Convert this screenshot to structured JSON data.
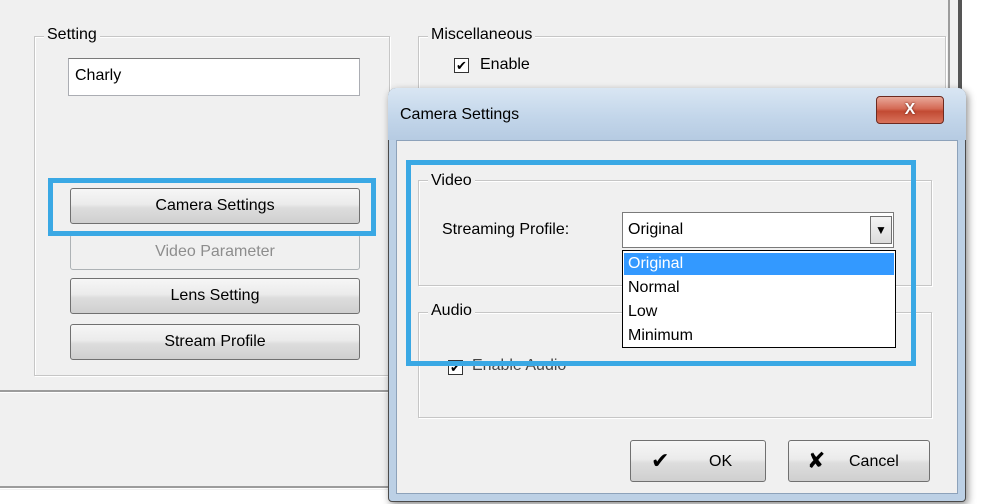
{
  "setting": {
    "group_title": "Setting",
    "name_value": "Charly",
    "buttons": {
      "camera_settings": "Camera Settings",
      "video_parameter": "Video Parameter",
      "lens_setting": "Lens Setting",
      "stream_profile": "Stream Profile"
    }
  },
  "misc": {
    "group_title": "Miscellaneous",
    "enable_label": "Enable",
    "enable_checked": "✔"
  },
  "dialog": {
    "title": "Camera Settings",
    "close_glyph": "X",
    "video": {
      "group_title": "Video",
      "streaming_profile_label": "Streaming Profile:",
      "selected_value": "Original",
      "options": [
        "Original",
        "Normal",
        "Low",
        "Minimum"
      ]
    },
    "audio": {
      "group_title": "Audio",
      "enable_audio_label": "Enable Audio",
      "enable_audio_checked": "✔"
    },
    "ok_label": "OK",
    "cancel_label": "Cancel",
    "ok_glyph": "✔",
    "cancel_glyph": "✘"
  },
  "colors": {
    "highlight": "#3aa8e4",
    "selection": "#3399ff",
    "close_button": "#c94a33"
  }
}
